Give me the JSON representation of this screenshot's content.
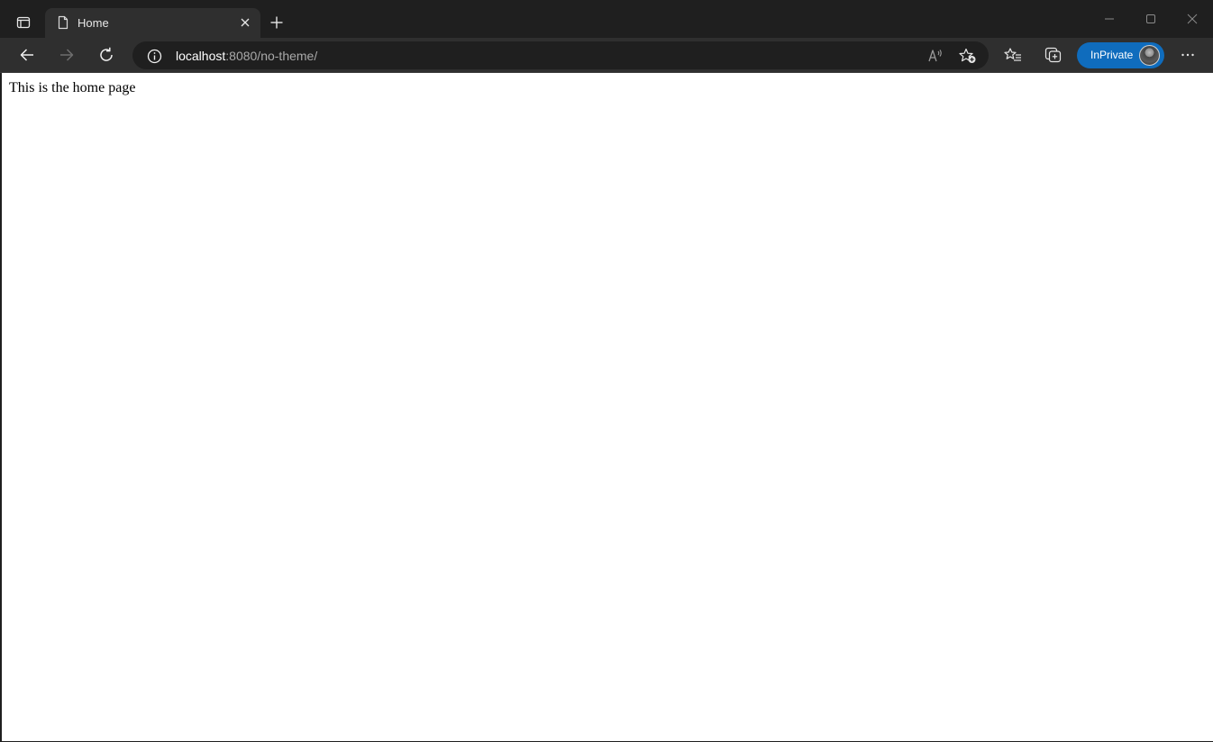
{
  "browser": {
    "tab": {
      "title": "Home"
    },
    "address": {
      "host": "localhost",
      "rest": ":8080/no-theme/"
    },
    "inprivate_label": "InPrivate",
    "colors": {
      "chrome_dark": "#1f1f1f",
      "toolbar": "#2f2f2f",
      "inprivate_blue": "#0f6cbd"
    },
    "icons": {
      "tab_actions": "tab-actions-icon",
      "favicon": "page-icon",
      "close_tab": "close-icon",
      "new_tab": "plus-icon",
      "back": "back-arrow-icon",
      "forward": "forward-arrow-icon",
      "refresh": "refresh-icon",
      "site_info": "info-icon",
      "read_aloud": "read-aloud-icon",
      "add_favorite": "star-add-icon",
      "favorites": "favorites-icon",
      "collections": "collections-icon",
      "more": "more-icon"
    }
  },
  "page": {
    "text": "This is the home page"
  }
}
